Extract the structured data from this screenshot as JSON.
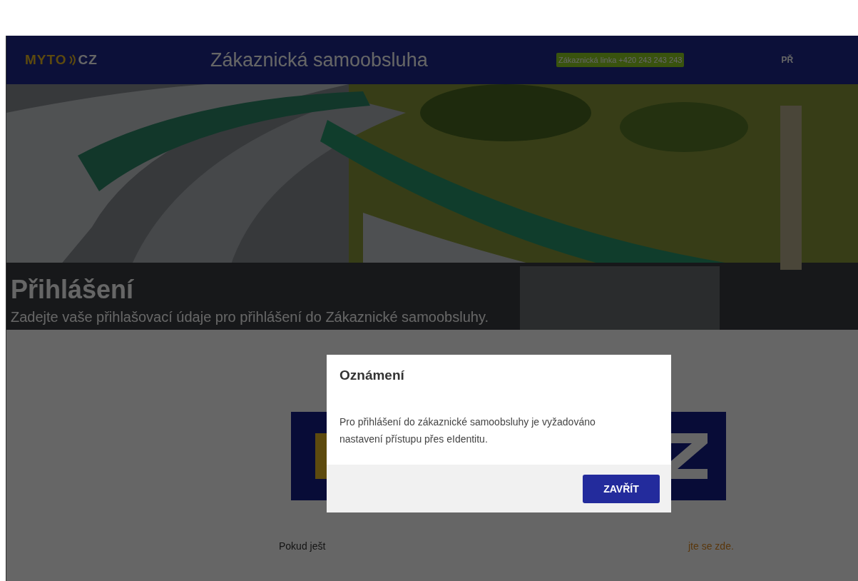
{
  "header": {
    "logo": {
      "left": "MYTO",
      "right": "CZ"
    },
    "title": "Zákaznická samoobsluha",
    "hotline": "Zákaznická linka +420 243 243 243",
    "nav_cut": "PŘ"
  },
  "hero": {
    "kind": "picture",
    "title": "Přihlášení",
    "subtitle": "Zadejte vaše přihlašovací údaje pro přihlášení do Zákaznické samoobsluhy."
  },
  "content": {
    "text_left": "Pokud ješt",
    "link_right": "jte se zde."
  },
  "dialog": {
    "title": "Oznámení",
    "message": "Pro přihlášení do zákaznické samoobsluhy je vyžadováno nastavení přístupu přes eIdentitu.",
    "button": "ZAVŘÍT"
  }
}
